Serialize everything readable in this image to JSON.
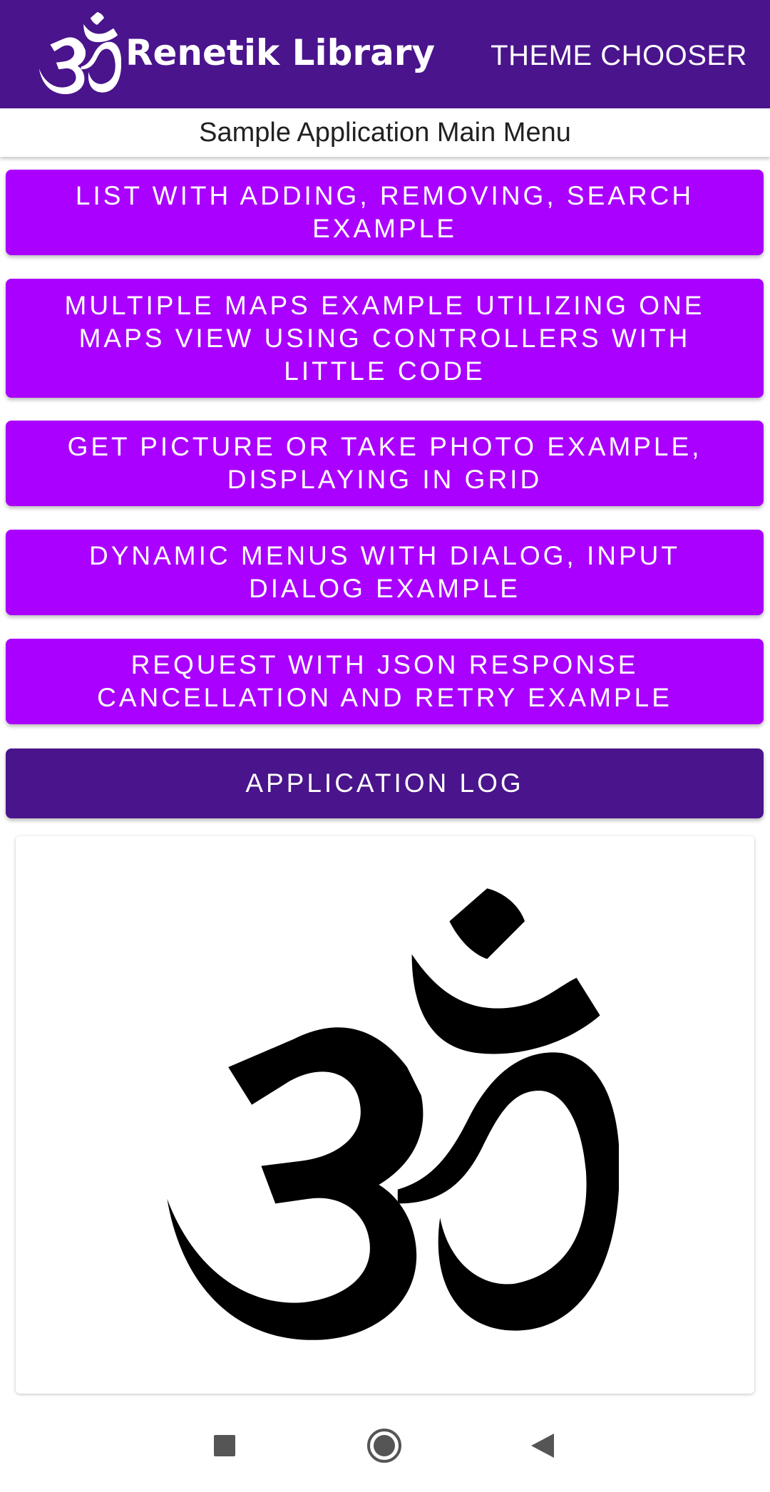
{
  "app_bar": {
    "title": "Renetik Library",
    "action_label": "THEME CHOOSER",
    "logo_icon": "om-symbol-icon",
    "background": "#4a148c"
  },
  "subtitle": "Sample Application Main Menu",
  "menu": {
    "items": [
      {
        "label": "LIST WITH ADDING, REMOVING, SEARCH EXAMPLE",
        "color": "#aa00ff"
      },
      {
        "label": "MULTIPLE MAPS EXAMPLE UTILIZING ONE MAPS VIEW USING CONTROLLERS WITH LITTLE CODE",
        "color": "#aa00ff"
      },
      {
        "label": "GET PICTURE OR TAKE PHOTO EXAMPLE, DISPLAYING IN GRID",
        "color": "#aa00ff"
      },
      {
        "label": "DYNAMIC MENUS WITH DIALOG, INPUT DIALOG EXAMPLE",
        "color": "#aa00ff"
      },
      {
        "label": "REQUEST WITH JSON RESPONSE CANCELLATION AND RETRY EXAMPLE",
        "color": "#aa00ff"
      },
      {
        "label": "APPLICATION LOG",
        "color": "#4a148c"
      }
    ]
  },
  "image_card": {
    "icon": "om-symbol-icon"
  },
  "nav_bar": {
    "icons": [
      "recents-square-icon",
      "home-circle-icon",
      "back-triangle-icon"
    ]
  }
}
